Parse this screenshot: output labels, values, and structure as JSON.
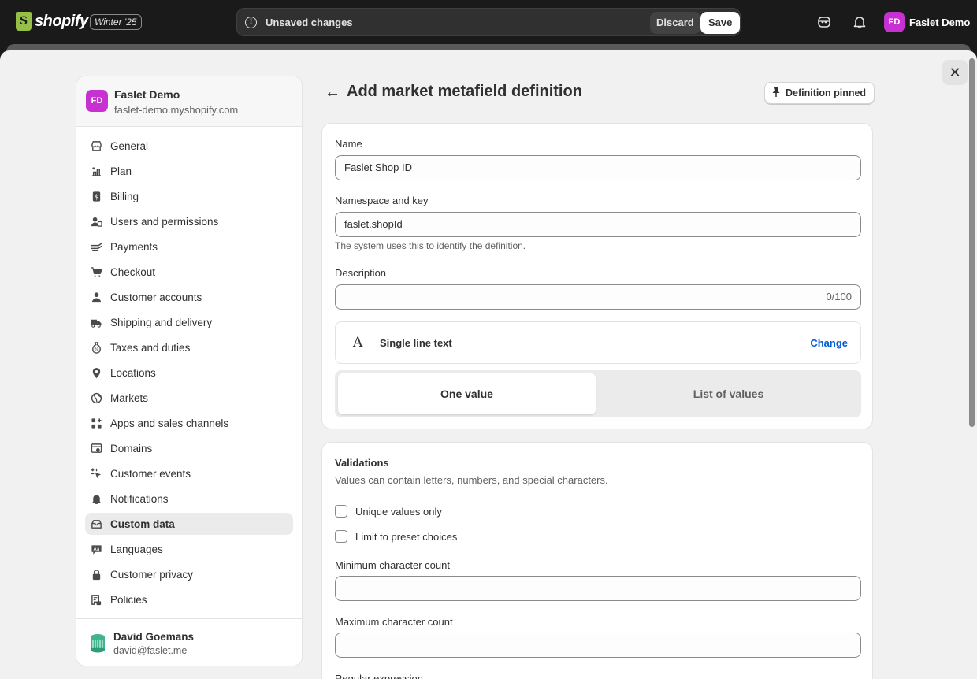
{
  "topbar": {
    "logo_text": "shopify",
    "edition": "Winter '25",
    "unsaved_text": "Unsaved changes",
    "discard_label": "Discard",
    "save_label": "Save",
    "user_initials": "FD",
    "user_name": "Faslet Demo"
  },
  "sidebar": {
    "store_initials": "FD",
    "store_name": "Faslet Demo",
    "store_domain": "faslet-demo.myshopify.com",
    "items": [
      {
        "label": "General",
        "icon": "store-icon"
      },
      {
        "label": "Plan",
        "icon": "plan-icon"
      },
      {
        "label": "Billing",
        "icon": "billing-icon"
      },
      {
        "label": "Users and permissions",
        "icon": "users-icon"
      },
      {
        "label": "Payments",
        "icon": "payments-icon"
      },
      {
        "label": "Checkout",
        "icon": "cart-icon"
      },
      {
        "label": "Customer accounts",
        "icon": "person-icon"
      },
      {
        "label": "Shipping and delivery",
        "icon": "truck-icon"
      },
      {
        "label": "Taxes and duties",
        "icon": "tax-icon"
      },
      {
        "label": "Locations",
        "icon": "location-icon"
      },
      {
        "label": "Markets",
        "icon": "globe-icon"
      },
      {
        "label": "Apps and sales channels",
        "icon": "apps-icon"
      },
      {
        "label": "Domains",
        "icon": "domain-icon"
      },
      {
        "label": "Customer events",
        "icon": "cursor-icon"
      },
      {
        "label": "Notifications",
        "icon": "bell-icon"
      },
      {
        "label": "Custom data",
        "icon": "database-icon"
      },
      {
        "label": "Languages",
        "icon": "language-icon"
      },
      {
        "label": "Customer privacy",
        "icon": "lock-icon"
      },
      {
        "label": "Policies",
        "icon": "policy-icon"
      }
    ],
    "active_item": "Custom data",
    "user_name": "David Goemans",
    "user_email": "david@faslet.me"
  },
  "page": {
    "title": "Add market metafield definition",
    "pin_label": "Definition pinned"
  },
  "form": {
    "name_label": "Name",
    "name_value": "Faslet Shop ID",
    "namespace_label": "Namespace and key",
    "namespace_value": "faslet.shopId",
    "namespace_help": "The system uses this to identify the definition.",
    "description_label": "Description",
    "description_value": "",
    "description_counter": "0/100",
    "type_label": "Single line text",
    "type_change": "Change",
    "one_value": "One value",
    "list_values": "List of values"
  },
  "validations": {
    "title": "Validations",
    "subtitle": "Values can contain letters, numbers, and special characters.",
    "unique_label": "Unique values only",
    "preset_label": "Limit to preset choices",
    "min_label": "Minimum character count",
    "max_label": "Maximum character count",
    "regex_label": "Regular expression"
  },
  "colors": {
    "accent": "#005bd3",
    "avatar": "#c831d1",
    "topbar": "#1a1a1a",
    "logo_green": "#95bf47"
  }
}
